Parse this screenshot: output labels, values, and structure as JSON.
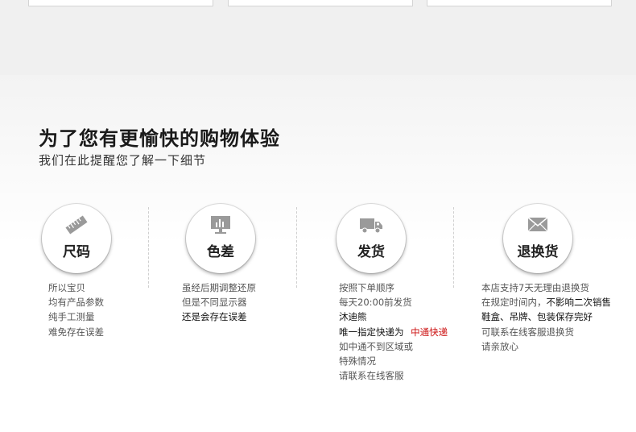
{
  "heading": {
    "title": "为了您有更愉快的购物体验",
    "subtitle": "我们在此提醒您了解一下细节"
  },
  "icons": [
    "ruler-icon",
    "monitor-chart-icon",
    "truck-icon",
    "envelope-icon"
  ],
  "sections": {
    "size": {
      "label": "尺码",
      "lines": [
        "所以宝贝",
        "均有产品参数",
        "纯手工测量",
        "难免存在误差"
      ]
    },
    "color": {
      "label": "色差",
      "lines": [
        "虽经后期调整还原",
        "但是不同显示器",
        "还是会存在误差"
      ]
    },
    "shipping": {
      "label": "发货",
      "lines": [
        "按照下单顺序",
        "每天20:00前发货",
        "沐迪熊",
        "唯一指定快递为",
        "中通快递",
        "如中通不到区域或",
        "特殊情况",
        "请联系在线客服"
      ]
    },
    "returns": {
      "label": "退换货",
      "lines": [
        "本店支持7天无理由退换货",
        "在规定时间内，",
        "不影响二次销售",
        "鞋盒、吊牌、包装保存完好",
        "可联系在线客服退换货",
        "请亲放心"
      ]
    }
  },
  "colors": {
    "accent_red": "#cc1111",
    "text_dark": "#111111",
    "text_body": "#555555"
  }
}
